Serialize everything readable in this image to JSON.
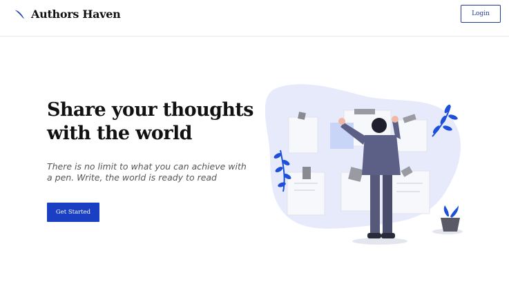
{
  "header": {
    "brand_name": "Authors Haven",
    "brand_icon": "quill-pen-icon",
    "login_label": "Login"
  },
  "hero": {
    "title": "Share your thoughts with the world",
    "subtitle": "There is no limit to what you can achieve with a pen. Write, the world is ready to read",
    "cta_label": "Get Started",
    "illustration": "person-arranging-notes-illustration"
  },
  "colors": {
    "accent": "#1b3fc3",
    "login_border": "#1f3a93",
    "blob": "#e6eafb",
    "leaf": "#1d4fd8"
  }
}
